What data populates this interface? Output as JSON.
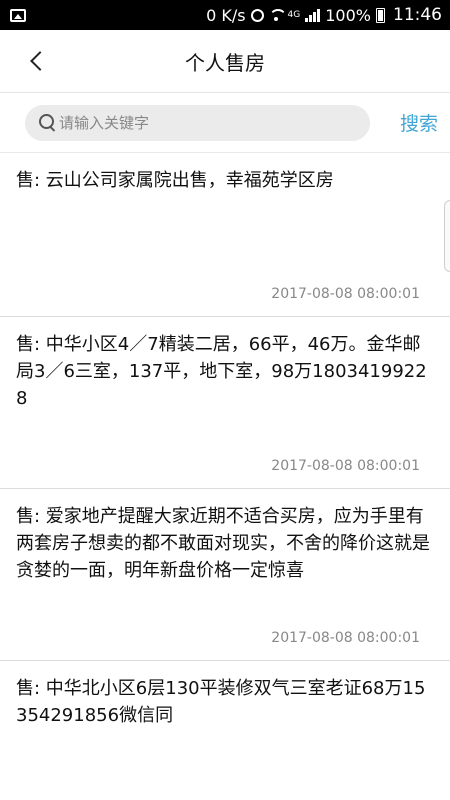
{
  "status_bar": {
    "network_speed": "0 K/s",
    "network_type": "4G",
    "battery": "100%",
    "time": "11:46"
  },
  "nav": {
    "title": "个人售房"
  },
  "search": {
    "placeholder": "请输入关键字",
    "value": "",
    "button_label": "搜索"
  },
  "listings": [
    {
      "text": "售: 云山公司家属院出售，幸福苑学区房",
      "date": "2017-08-08 08:00:01"
    },
    {
      "text": "售: 中华小区4／7精装二居，66平，46万。金华邮局3／6三室，137平，地下室，98万18034199228",
      "date": "2017-08-08 08:00:01"
    },
    {
      "text": "售: 爱家地产提醒大家近期不适合买房，应为手里有两套房子想卖的都不敢面对现实，不舍的降价这就是贪婪的一面，明年新盘价格一定惊喜",
      "date": "2017-08-08 08:00:01"
    },
    {
      "text": "售: 中华北小区6层130平装修双气三室老证68万15354291856微信同",
      "date": ""
    }
  ],
  "colors": {
    "accent": "#41a6d6",
    "search_bg": "#ebebeb",
    "date_text": "#888888"
  }
}
